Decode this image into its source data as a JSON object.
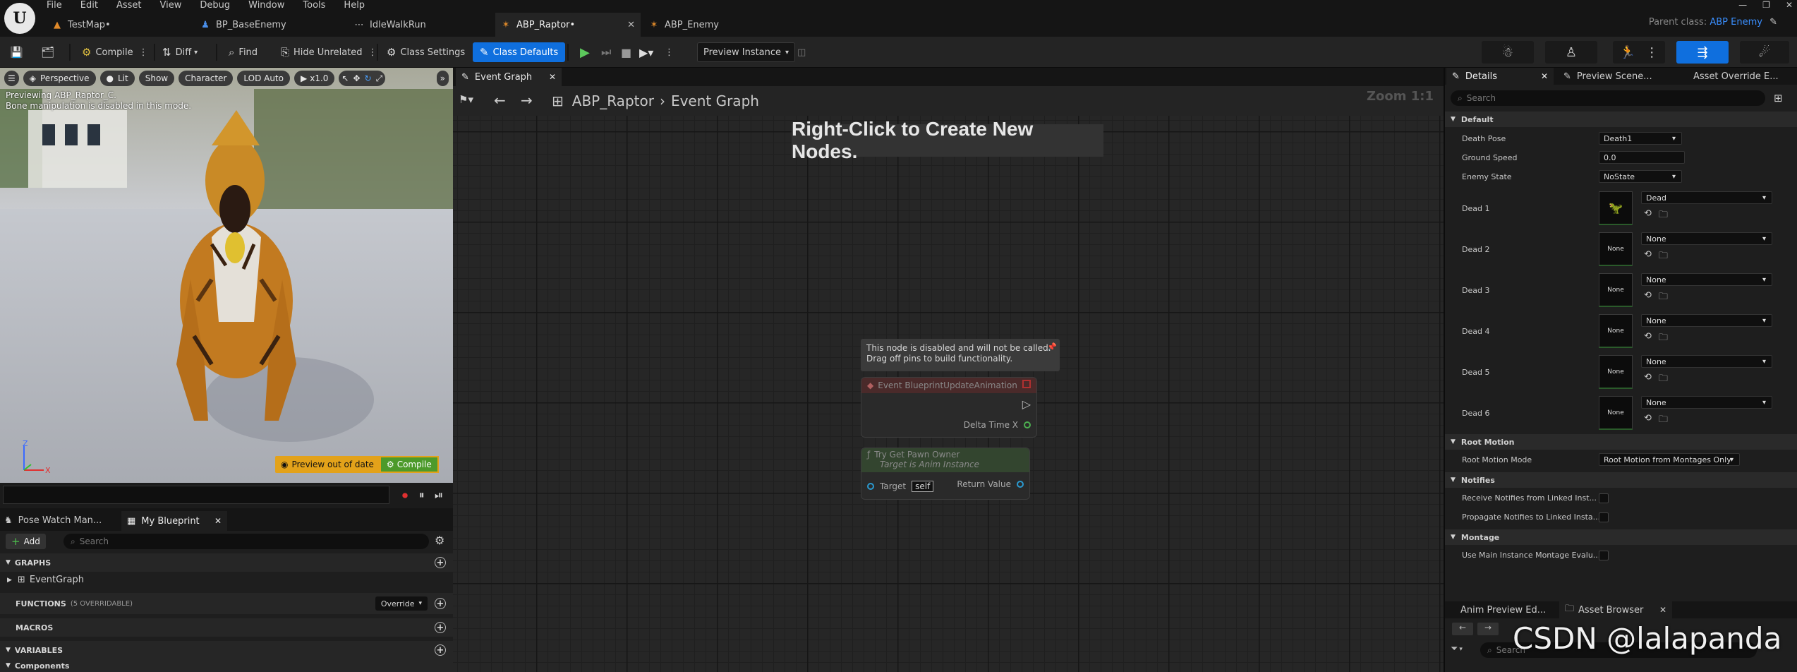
{
  "menu": [
    "File",
    "Edit",
    "Asset",
    "View",
    "Debug",
    "Window",
    "Tools",
    "Help"
  ],
  "tabs": [
    {
      "label": "TestMap•",
      "active": false
    },
    {
      "label": "BP_BaseEnemy",
      "active": false
    },
    {
      "label": "IdleWalkRun",
      "active": false
    },
    {
      "label": "ABP_Raptor•",
      "active": true
    },
    {
      "label": "ABP_Enemy",
      "active": false
    }
  ],
  "parent_class": {
    "label": "Parent class:",
    "value": "ABP Enemy"
  },
  "toolbar": {
    "compile": "Compile",
    "diff": "Diff",
    "find": "Find",
    "hide_unrelated": "Hide Unrelated",
    "class_settings": "Class Settings",
    "class_defaults": "Class Defaults",
    "preview_instance": "Preview Instance"
  },
  "viewport": {
    "perspective": "Perspective",
    "lit": "Lit",
    "show": "Show",
    "character": "Character",
    "lod": "LOD Auto",
    "speed": "x1.0",
    "info_line1": "Previewing ABP_Raptor_C.",
    "info_line2": "Bone manipulation is disabled in this mode.",
    "preview_out_of_date": "Preview out of date",
    "compile": "Compile",
    "axis_z": "Z",
    "axis_x": "X"
  },
  "bottom_tabs": {
    "pose_watch": "Pose Watch Man...",
    "my_blueprint": "My Blueprint"
  },
  "my_blueprint": {
    "add": "Add",
    "search_placeholder": "Search",
    "graphs": "GRAPHS",
    "event_graph": "EventGraph",
    "functions": "FUNCTIONS",
    "functions_count": "(5 OVERRIDABLE)",
    "override": "Override",
    "macros": "MACROS",
    "variables": "VARIABLES",
    "components": "Components"
  },
  "graph": {
    "tab": "Event Graph",
    "breadcrumb_root": "ABP_Raptor",
    "breadcrumb_sep": "›",
    "breadcrumb_current": "Event Graph",
    "hint": "Right-Click to Create New Nodes.",
    "zoom": "Zoom 1:1",
    "disabled_line1": "This node is disabled and will not be called.",
    "disabled_line2": "Drag off pins to build functionality.",
    "event_node": {
      "title": "Event BlueprintUpdateAnimation",
      "pin": "Delta Time X"
    },
    "pawn_node": {
      "title": "Try Get Pawn Owner",
      "subtitle": "Target is Anim Instance",
      "target": "Target",
      "self": "self",
      "return": "Return Value"
    }
  },
  "details": {
    "tabs": [
      "Details",
      "Preview Scene...",
      "Asset Override E..."
    ],
    "search_placeholder": "Search",
    "categories": {
      "default": "Default",
      "root_motion": "Root Motion",
      "notifies": "Notifies",
      "montage": "Montage"
    },
    "death_pose": {
      "label": "Death Pose",
      "value": "Death1"
    },
    "ground_speed": {
      "label": "Ground Speed",
      "value": "0.0"
    },
    "enemy_state": {
      "label": "Enemy State",
      "value": "NoState"
    },
    "dead": [
      {
        "label": "Dead 1",
        "value": "Dead",
        "thumb": ""
      },
      {
        "label": "Dead 2",
        "value": "None",
        "thumb": "None"
      },
      {
        "label": "Dead 3",
        "value": "None",
        "thumb": "None"
      },
      {
        "label": "Dead 4",
        "value": "None",
        "thumb": "None"
      },
      {
        "label": "Dead 5",
        "value": "None",
        "thumb": "None"
      },
      {
        "label": "Dead 6",
        "value": "None",
        "thumb": "None"
      }
    ],
    "root_motion_mode": {
      "label": "Root Motion Mode",
      "value": "Root Motion from Montages Only"
    },
    "notify1": "Receive Notifies from Linked Inst...",
    "notify2": "Propagate Notifies to Linked Insta...",
    "montage1": "Use Main Instance Montage Evalu...",
    "bottom_tabs": [
      "Anim Preview Ed...",
      "Asset Browser"
    ],
    "bottom_search": "Search"
  },
  "watermark": "CSDN @lalapanda",
  "colors": {
    "accent": "#0f6fde",
    "link": "#3a8fff",
    "warning": "#e3a21a",
    "compile_green": "#4c9a2a"
  }
}
